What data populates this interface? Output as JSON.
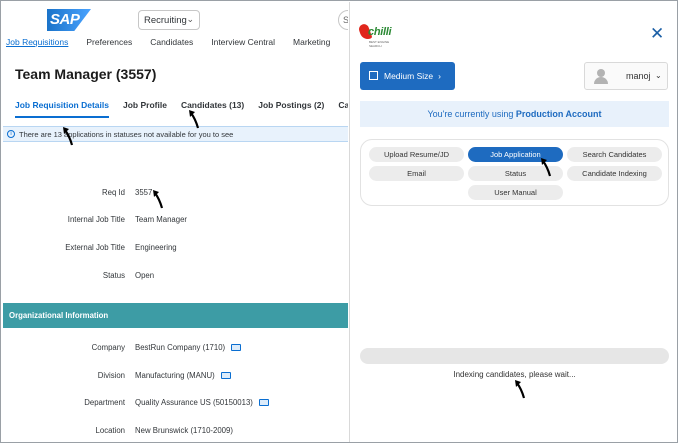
{
  "left": {
    "logo": "SAP",
    "module": "Recruiting",
    "search_placeholder": "Se",
    "topnav": [
      "Job Requisitions",
      "Preferences",
      "Candidates",
      "Interview Central",
      "Marketing",
      "M"
    ],
    "title": "Team Manager (3557)",
    "tabs": [
      "Job Requisition Details",
      "Job Profile",
      "Candidates (13)",
      "Job Postings (2)",
      "Candidat"
    ],
    "info": "There are 13 applications in statuses not available for you to see",
    "info_icon": "info-icon",
    "fields": [
      {
        "label": "Req Id",
        "value": "3557"
      },
      {
        "label": "Internal Job Title",
        "value": "Team Manager"
      },
      {
        "label": "External Job Title",
        "value": "Engineering"
      },
      {
        "label": "Status",
        "value": "Open"
      }
    ],
    "org_header": "Organizational Information",
    "org_fields": [
      {
        "label": "Company",
        "value": "BestRun Company (1710)"
      },
      {
        "label": "Division",
        "value": "Manufacturing (MANU)"
      },
      {
        "label": "Department",
        "value": "Quality Assurance US (50150013)"
      },
      {
        "label": "Location",
        "value": "New Brunswick (1710-2009)"
      }
    ]
  },
  "right": {
    "brand": "chilli",
    "brand_tag": "BEST ENGINE SEARCH",
    "close_icon": "close-icon",
    "size_button": "Medium Size",
    "user": "manoj",
    "production_prefix": "You're currently using ",
    "production_name": "Production Account",
    "buttons": [
      "Upload Resume/JD",
      "Job Application",
      "Search Candidates",
      "Email",
      "Status",
      "Candidate Indexing",
      "User Manual"
    ],
    "active_button": "Job Application",
    "indexing_text": "Indexing candidates, please wait...",
    "progress": 0
  },
  "colors": {
    "accent": "#1e6bc0",
    "sap_link": "#0a6ed1",
    "org_bar": "#3d9ca5",
    "prod_bg": "#e8f1fb"
  }
}
